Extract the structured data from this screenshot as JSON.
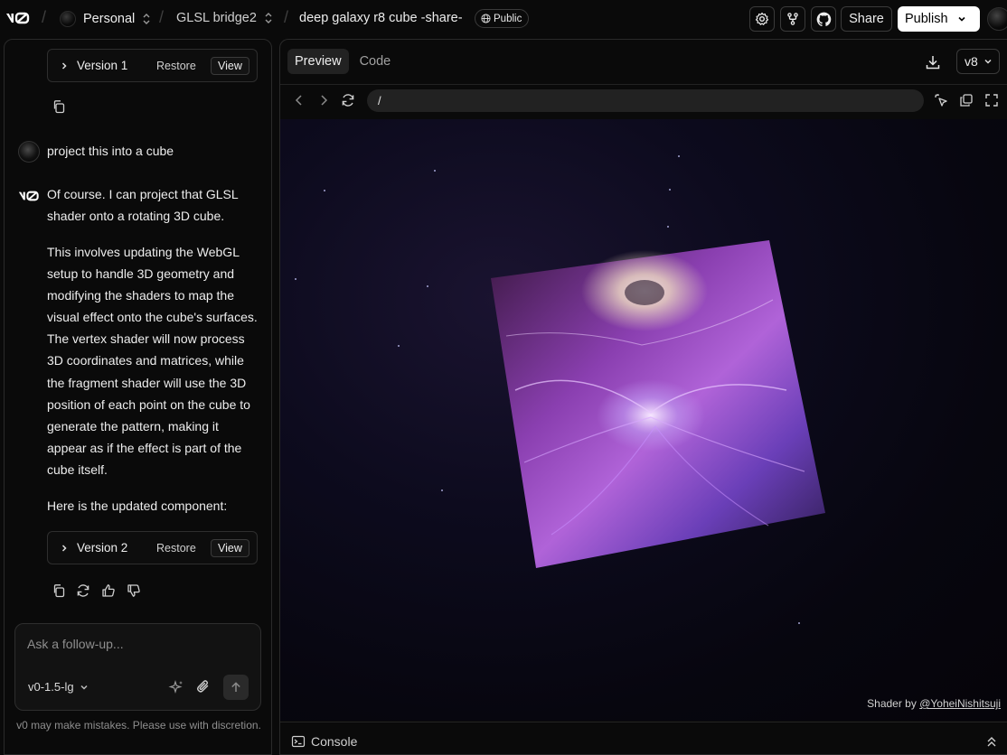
{
  "header": {
    "workspace": "Personal",
    "project": "GLSL bridge2",
    "chat_title": "deep galaxy r8 cube -share-",
    "visibility": "Public",
    "share_label": "Share",
    "publish_label": "Publish"
  },
  "chat": {
    "version1": {
      "label": "Version 1",
      "restore": "Restore",
      "view": "View"
    },
    "user_message": "project this into a cube",
    "assistant_paragraphs": [
      "Of course. I can project that GLSL shader onto a rotating 3D cube.",
      "This involves updating the WebGL setup to handle 3D geometry and modifying the shaders to map the visual effect onto the cube's surfaces. The vertex shader will now process 3D coordinates and matrices, while the fragment shader will use the 3D position of each point on the cube to generate the pattern, making it appear as if the effect is part of the cube itself.",
      "Here is the updated component:"
    ],
    "version2": {
      "label": "Version 2",
      "restore": "Restore",
      "view": "View"
    },
    "input_placeholder": "Ask a follow-up...",
    "model": "v0-1.5-lg",
    "disclaimer": "v0 may make mistakes. Please use with discretion."
  },
  "preview": {
    "tabs": [
      "Preview",
      "Code"
    ],
    "version_select": "v8",
    "url": "/",
    "credit_prefix": "Shader by ",
    "credit_link": "@YoheiNishitsuji",
    "console_label": "Console"
  },
  "colors": {
    "background": "#0a0a0a",
    "border": "#2a2a2a",
    "accent_white": "#ffffff"
  }
}
